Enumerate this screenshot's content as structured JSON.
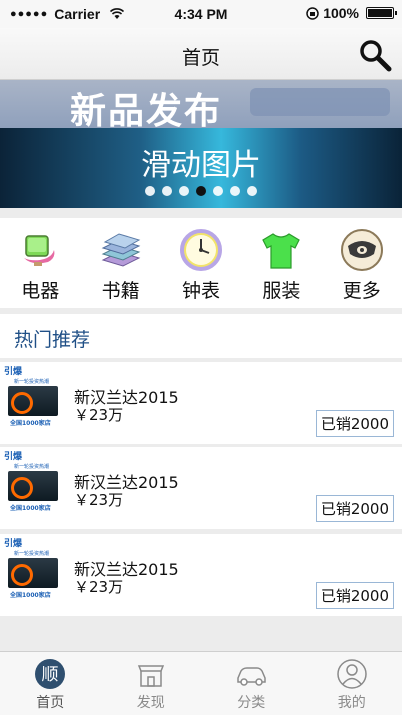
{
  "status_bar": {
    "carrier": "Carrier",
    "time": "4:34 PM",
    "battery": "100%"
  },
  "nav": {
    "title": "首页"
  },
  "banner": {
    "headline": "新品发布",
    "caption": "滑动图片",
    "page_count": 7,
    "active_page": 4
  },
  "categories": [
    {
      "label": "电器",
      "icon": "appliance-icon"
    },
    {
      "label": "书籍",
      "icon": "books-icon"
    },
    {
      "label": "钟表",
      "icon": "clock-icon"
    },
    {
      "label": "服装",
      "icon": "tshirt-icon"
    },
    {
      "label": "更多",
      "icon": "more-icon"
    }
  ],
  "section": {
    "title": "热门推荐"
  },
  "items": [
    {
      "title": "新汉兰达2015",
      "price": "￥23万",
      "badge": "已销2000",
      "thumb_tag": "引爆",
      "thumb_sub": "新一轮投资热潮",
      "thumb_foot": "全国1000家店"
    },
    {
      "title": "新汉兰达2015",
      "price": "￥23万",
      "badge": "已销2000",
      "thumb_tag": "引爆",
      "thumb_sub": "新一轮投资热潮",
      "thumb_foot": "全国1000家店"
    },
    {
      "title": "新汉兰达2015",
      "price": "￥23万",
      "badge": "已销2000",
      "thumb_tag": "引爆",
      "thumb_sub": "新一轮投资热潮",
      "thumb_foot": "全国1000家店"
    }
  ],
  "tabs": [
    {
      "label": "首页",
      "icon": "home-icon",
      "active": true
    },
    {
      "label": "发现",
      "icon": "shop-icon",
      "active": false
    },
    {
      "label": "分类",
      "icon": "car-icon",
      "active": false
    },
    {
      "label": "我的",
      "icon": "user-icon",
      "active": false
    }
  ],
  "colors": {
    "accent": "#1f4f86",
    "badge_border": "#9ab7d6",
    "tab_active": "#1f4f86"
  }
}
